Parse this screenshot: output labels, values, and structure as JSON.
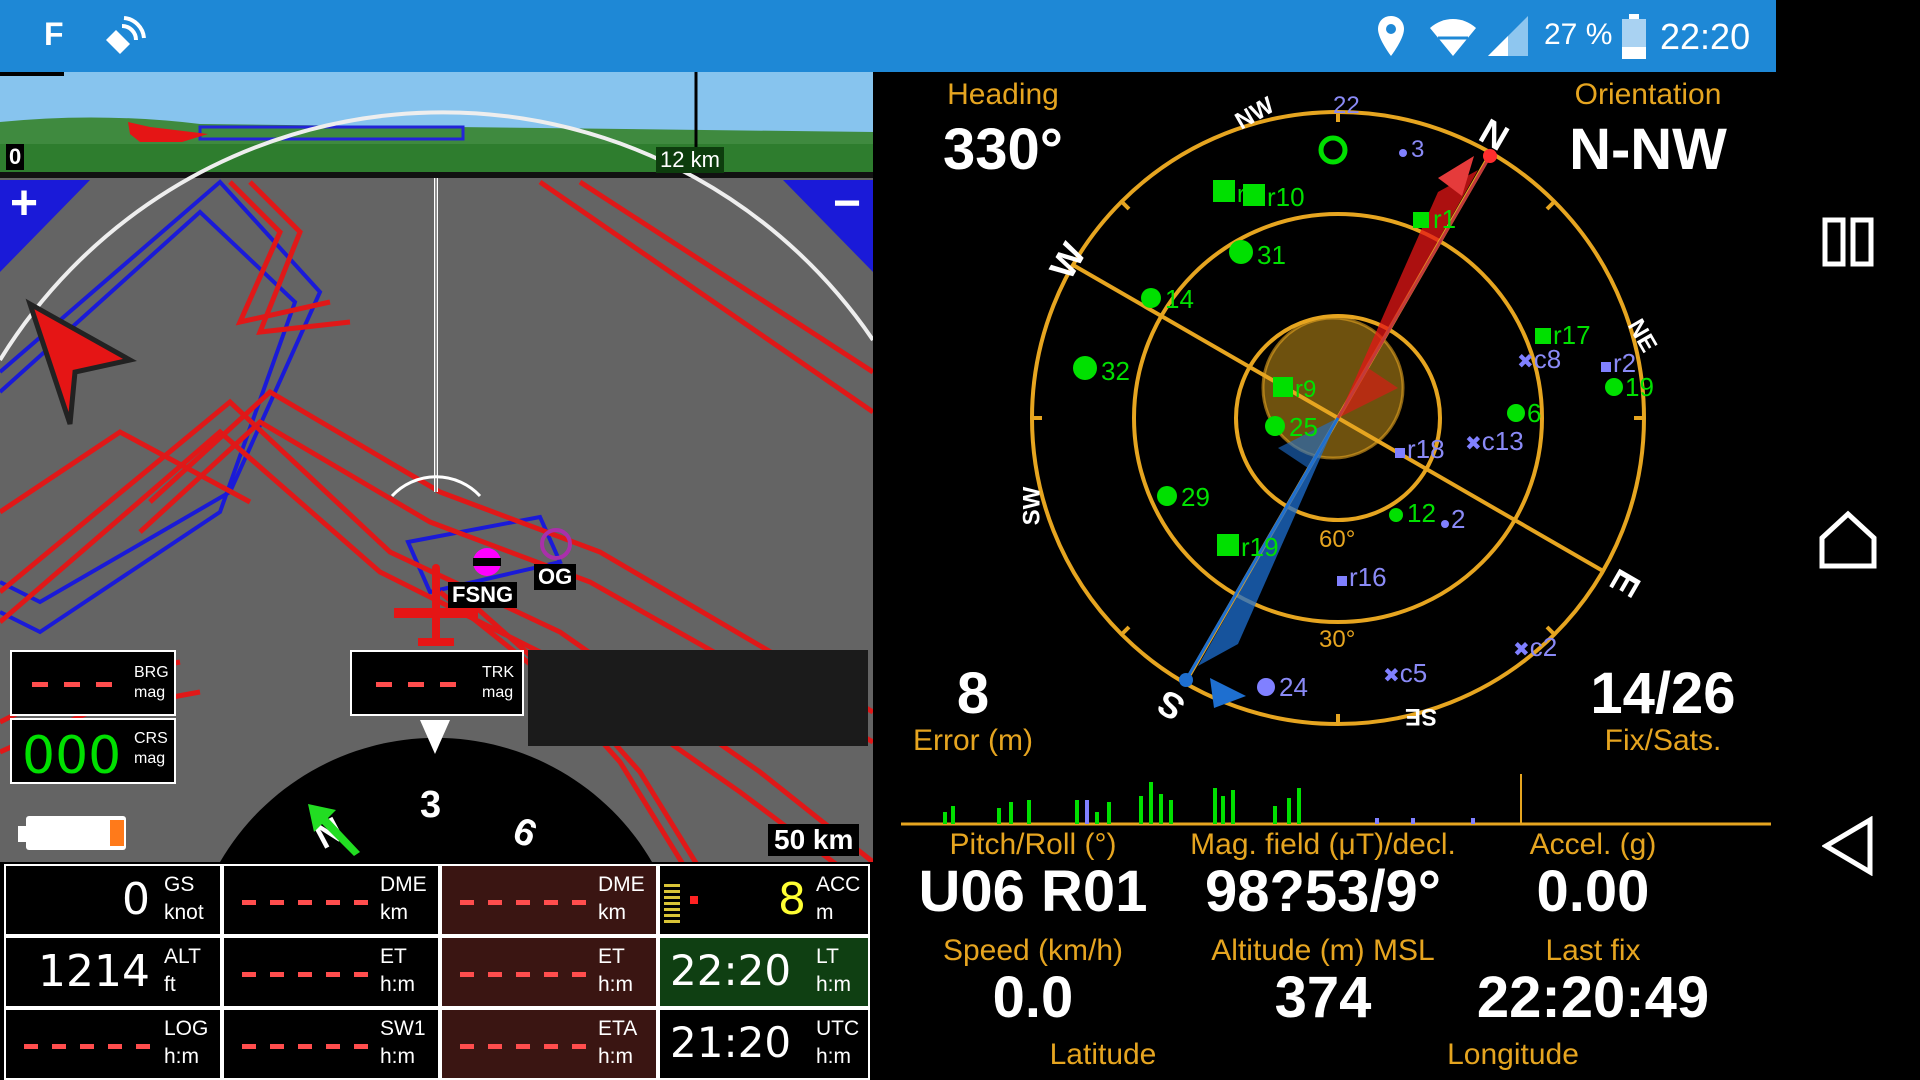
{
  "status_bar": {
    "left_letter": "F",
    "battery_percent": "27 %",
    "time": "22:20",
    "icons": [
      "location-pin-icon",
      "wifi-icon",
      "signal-icon",
      "battery-icon",
      "tracking-icon"
    ]
  },
  "nav_buttons": [
    "recent-apps-icon",
    "home-icon",
    "back-icon"
  ],
  "map": {
    "profile_zero": "0",
    "profile_distance": "12 km",
    "scale": "50 km",
    "waypoints": [
      "FSNG",
      "OG"
    ],
    "zoom_in": "+",
    "zoom_out": "−"
  },
  "brg": {
    "value": "- - -",
    "label1": "BRG",
    "label2": "mag"
  },
  "crs": {
    "value": "000",
    "label1": "CRS",
    "label2": "mag"
  },
  "trk": {
    "value": "- - -",
    "label1": "TRK",
    "label2": "mag"
  },
  "compass": {
    "tick3": "3",
    "tick6": "6",
    "tickN": "N"
  },
  "grid": {
    "gs": {
      "value": "0",
      "label1": "GS",
      "label2": "knot"
    },
    "dme1": {
      "value": "- - - - -",
      "label1": "DME",
      "label2": "km"
    },
    "dme2": {
      "value": "- - - - -",
      "label1": "DME",
      "label2": "km"
    },
    "acc": {
      "value": "8",
      "label1": "ACC",
      "label2": "m"
    },
    "alt": {
      "value": "1214",
      "label1": "ALT",
      "label2": "ft"
    },
    "et1": {
      "value": "- - - - -",
      "label1": "ET",
      "label2": "h:m"
    },
    "et2": {
      "value": "- - - - -",
      "label1": "ET",
      "label2": "h:m"
    },
    "lt": {
      "value": "22:20",
      "label1": "LT",
      "label2": "h:m"
    },
    "log": {
      "value": "- - - - -",
      "label1": "LOG",
      "label2": "h:m"
    },
    "sw1": {
      "value": "- - - - -",
      "label1": "SW1",
      "label2": "h:m"
    },
    "eta": {
      "value": "- - - - -",
      "label1": "ETA",
      "label2": "h:m"
    },
    "utc": {
      "value": "21:20",
      "label1": "UTC",
      "label2": "h:m"
    }
  },
  "gps": {
    "heading_label": "Heading",
    "heading_value": "330°",
    "orientation_label": "Orientation",
    "orientation_value": "N-NW",
    "error_value": "8",
    "error_label": "Error (m)",
    "fix_value": "14/26",
    "fix_label": "Fix/Sats.",
    "ring_60": "60°",
    "ring_30": "30°",
    "cardinals": {
      "N": "N",
      "NE": "NE",
      "E": "E",
      "SE": "SE",
      "S": "S",
      "SW": "SW",
      "W": "W",
      "NW": "NW"
    },
    "satellites": [
      {
        "id": "22",
        "type": "glonass"
      },
      {
        "id": "3",
        "type": "glonass"
      },
      {
        "id": "r8",
        "type": "gps-sq"
      },
      {
        "id": "r10",
        "type": "gps-sq"
      },
      {
        "id": "r1",
        "type": "gps-sq"
      },
      {
        "id": "31",
        "type": "gps"
      },
      {
        "id": "14",
        "type": "gps"
      },
      {
        "id": "r17",
        "type": "gps-sq"
      },
      {
        "id": "c8",
        "type": "other"
      },
      {
        "id": "r2",
        "type": "other"
      },
      {
        "id": "19",
        "type": "gps"
      },
      {
        "id": "32",
        "type": "gps"
      },
      {
        "id": "r9",
        "type": "gps-sq"
      },
      {
        "id": "25",
        "type": "gps"
      },
      {
        "id": "6",
        "type": "gps"
      },
      {
        "id": "r18",
        "type": "other"
      },
      {
        "id": "c13",
        "type": "other"
      },
      {
        "id": "29",
        "type": "gps"
      },
      {
        "id": "12",
        "type": "gps"
      },
      {
        "id": "2",
        "type": "glonass"
      },
      {
        "id": "r19",
        "type": "gps-sq"
      },
      {
        "id": "r16",
        "type": "other"
      },
      {
        "id": "c2",
        "type": "other"
      },
      {
        "id": "c5",
        "type": "other"
      },
      {
        "id": "24",
        "type": "glonass"
      }
    ],
    "pitch_label": "Pitch/Roll (°)",
    "pitch_value": "U06 R01",
    "mag_label": "Mag. field (μT)/decl.",
    "mag_value": "98?53/9°",
    "accel_label": "Accel. (g)",
    "accel_value": "0.00",
    "speed_label": "Speed (km/h)",
    "speed_value": "0.0",
    "altitude_label": "Altitude (m) MSL",
    "altitude_value": "374",
    "lastfix_label": "Last fix",
    "lastfix_value": "22:20:49",
    "latitude_label": "Latitude",
    "longitude_label": "Longitude"
  },
  "colors": {
    "status_bar": "#1e88d6",
    "accent_orange": "#e6a520",
    "airspace_red": "#e01818",
    "airspace_blue": "#1a1ad8",
    "gps_green": "#00e000",
    "glonass_purple": "#8080ff"
  }
}
